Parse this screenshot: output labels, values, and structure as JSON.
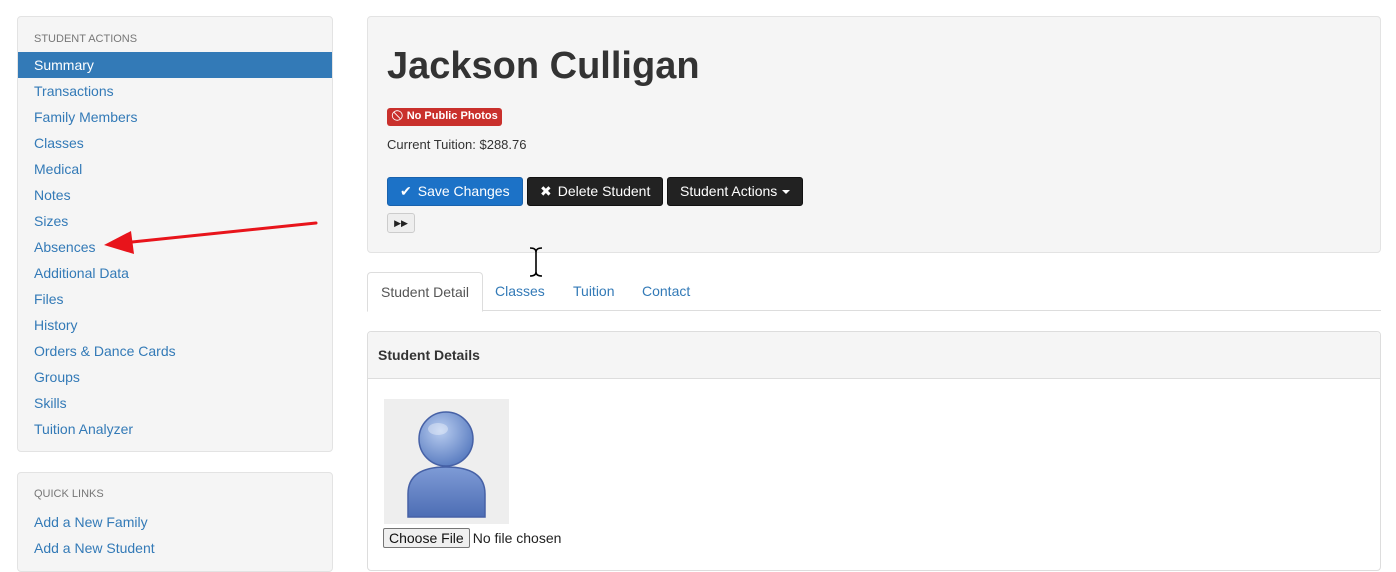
{
  "sidebar": {
    "actions_heading": "STUDENT ACTIONS",
    "items": [
      {
        "label": "Summary"
      },
      {
        "label": "Transactions"
      },
      {
        "label": "Family Members"
      },
      {
        "label": "Classes"
      },
      {
        "label": "Medical"
      },
      {
        "label": "Notes"
      },
      {
        "label": "Sizes"
      },
      {
        "label": "Absences"
      },
      {
        "label": "Additional Data"
      },
      {
        "label": "Files"
      },
      {
        "label": "History"
      },
      {
        "label": "Orders & Dance Cards"
      },
      {
        "label": "Groups"
      },
      {
        "label": "Skills"
      },
      {
        "label": "Tuition Analyzer"
      }
    ],
    "active_item": "Summary",
    "quick_links_heading": "QUICK LINKS",
    "quick_links": [
      {
        "label": "Add a New Family"
      },
      {
        "label": "Add a New Student"
      }
    ]
  },
  "header": {
    "student_name": "Jackson Culligan",
    "badge_label": "No Public Photos",
    "tuition_text": "Current Tuition: $288.76",
    "save_label": "Save Changes",
    "delete_label": "Delete Student",
    "actions_label": "Student Actions",
    "fast_forward_icon": "fast-forward-icon"
  },
  "tabs": [
    {
      "label": "Student Detail",
      "active": true
    },
    {
      "label": "Classes",
      "active": false
    },
    {
      "label": "Tuition",
      "active": false
    },
    {
      "label": "Contact",
      "active": false
    }
  ],
  "details": {
    "heading": "Student Details",
    "choose_file_label": "Choose File",
    "file_status": "No file chosen"
  },
  "colors": {
    "primary": "#337ab7",
    "save_button": "#1c72c7",
    "dark_button": "#222222",
    "badge": "#c9302c",
    "annotation_arrow": "#e8141b"
  }
}
